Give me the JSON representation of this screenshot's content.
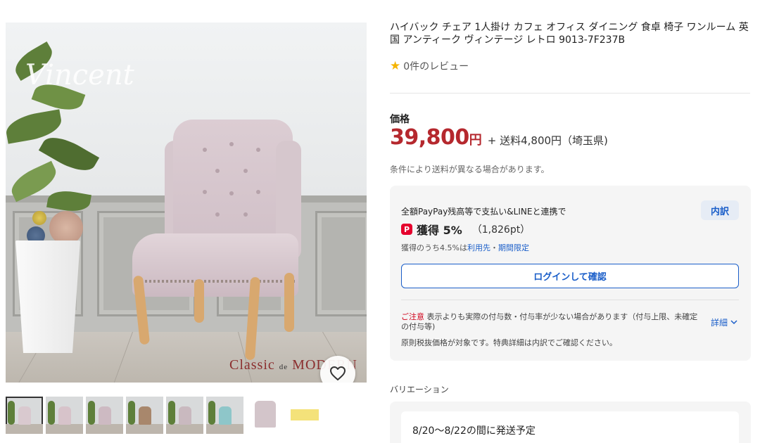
{
  "gallery": {
    "main_image": {
      "script_logo_text": "Vincent",
      "brand_text_big": "Classic",
      "brand_text_small": "de",
      "brand_text_end": "MODERN"
    },
    "favorite_icon": "heart-outline-icon",
    "thumbnails": [
      {
        "label": "thumbnail-1",
        "active": true,
        "tone": "#d9c9cf"
      },
      {
        "label": "thumbnail-2",
        "active": false,
        "tone": "#d7c3ca"
      },
      {
        "label": "thumbnail-3",
        "active": false,
        "tone": "#cdbac2"
      },
      {
        "label": "thumbnail-4",
        "active": false,
        "tone": "#a8876c"
      },
      {
        "label": "thumbnail-5",
        "active": false,
        "tone": "#c9b9bf"
      },
      {
        "label": "thumbnail-6",
        "active": false,
        "tone": "#8ec6c9"
      },
      {
        "label": "thumbnail-7",
        "active": false,
        "tone": "#d3c5ca"
      },
      {
        "label": "thumbnail-8",
        "active": false,
        "tone": "#f4e27a"
      }
    ]
  },
  "product": {
    "title": "ハイバック チェア 1人掛け カフェ オフィス ダイニング 食卓 椅子 ワンルーム 英国 アンティーク ヴィンテージ レトロ 9013-7F237B",
    "rating_text": "0件のレビュー",
    "price_label": "価格",
    "price_value": "39,800",
    "price_unit": "円",
    "shipping_text": "+ 送料4,800円（埼玉県)",
    "shipping_note": "条件により送料が異なる場合があります。"
  },
  "points": {
    "line1": "全額PayPay残高等で支払い&LINEと連携で",
    "breakdown_label": "内訳",
    "paypay_icon_glyph": "P",
    "earn_label": "獲得 5%",
    "earn_points": "（1,826pt）",
    "sub_prefix": "獲得のうち4.5%は",
    "sub_link1": "利用先",
    "sub_sep": "・",
    "sub_link2": "期間限定",
    "login_button": "ログインして確認",
    "caution_label": "ご注意",
    "caution_text": " 表示よりも実際の付与数・付与率が少ない場合があります（付与上限、未確定の付与等)",
    "details_label": "詳細",
    "note": "原則税抜価格が対象です。特典詳細は内訳でご確認ください。"
  },
  "variation": {
    "label": "バリエーション",
    "ship_date": "8/20〜8/22の間に発送予定"
  },
  "colors": {
    "price_red": "#b5282e",
    "link_blue": "#1a5ec9",
    "paypay_red": "#e5002d",
    "star_gold": "#f5b400"
  }
}
